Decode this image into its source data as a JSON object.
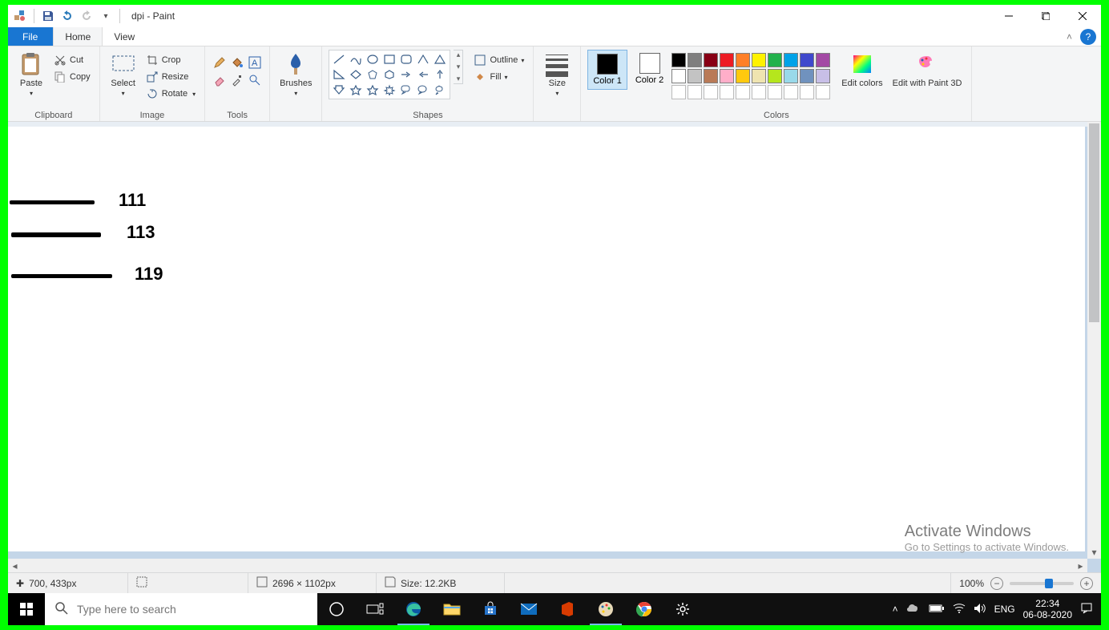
{
  "title": "dpi - Paint",
  "tabs": {
    "file": "File",
    "home": "Home",
    "view": "View"
  },
  "ribbon": {
    "clipboard": {
      "label": "Clipboard",
      "paste": "Paste",
      "cut": "Cut",
      "copy": "Copy"
    },
    "image": {
      "label": "Image",
      "select": "Select",
      "crop": "Crop",
      "resize": "Resize",
      "rotate": "Rotate"
    },
    "tools": {
      "label": "Tools"
    },
    "brushes": {
      "label": "Brushes"
    },
    "shapes": {
      "label": "Shapes",
      "outline": "Outline",
      "fill": "Fill"
    },
    "size": {
      "label": "Size"
    },
    "colors": {
      "label": "Colors",
      "color1": "Color 1",
      "color2": "Color 2",
      "edit": "Edit colors",
      "paint3d": "Edit with Paint 3D",
      "palette_row1": [
        "#000000",
        "#7f7f7f",
        "#880015",
        "#ed1c24",
        "#ff7f27",
        "#fff200",
        "#22b14c",
        "#00a2e8",
        "#3f48cc",
        "#a349a4"
      ],
      "palette_row2": [
        "#ffffff",
        "#c3c3c3",
        "#b97a57",
        "#ffaec9",
        "#ffc90e",
        "#efe4b0",
        "#b5e61d",
        "#99d9ea",
        "#7092be",
        "#c8bfe7"
      ]
    }
  },
  "canvas": {
    "labels": [
      "111",
      "113",
      "119"
    ]
  },
  "watermark": {
    "line1": "Activate Windows",
    "line2": "Go to Settings to activate Windows."
  },
  "status": {
    "cursor": "700, 433px",
    "canvas_size": "2696 × 1102px",
    "file_size": "Size: 12.2KB",
    "zoom": "100%"
  },
  "taskbar": {
    "search_placeholder": "Type here to search",
    "lang": "ENG",
    "time": "22:34",
    "date": "06-08-2020"
  }
}
